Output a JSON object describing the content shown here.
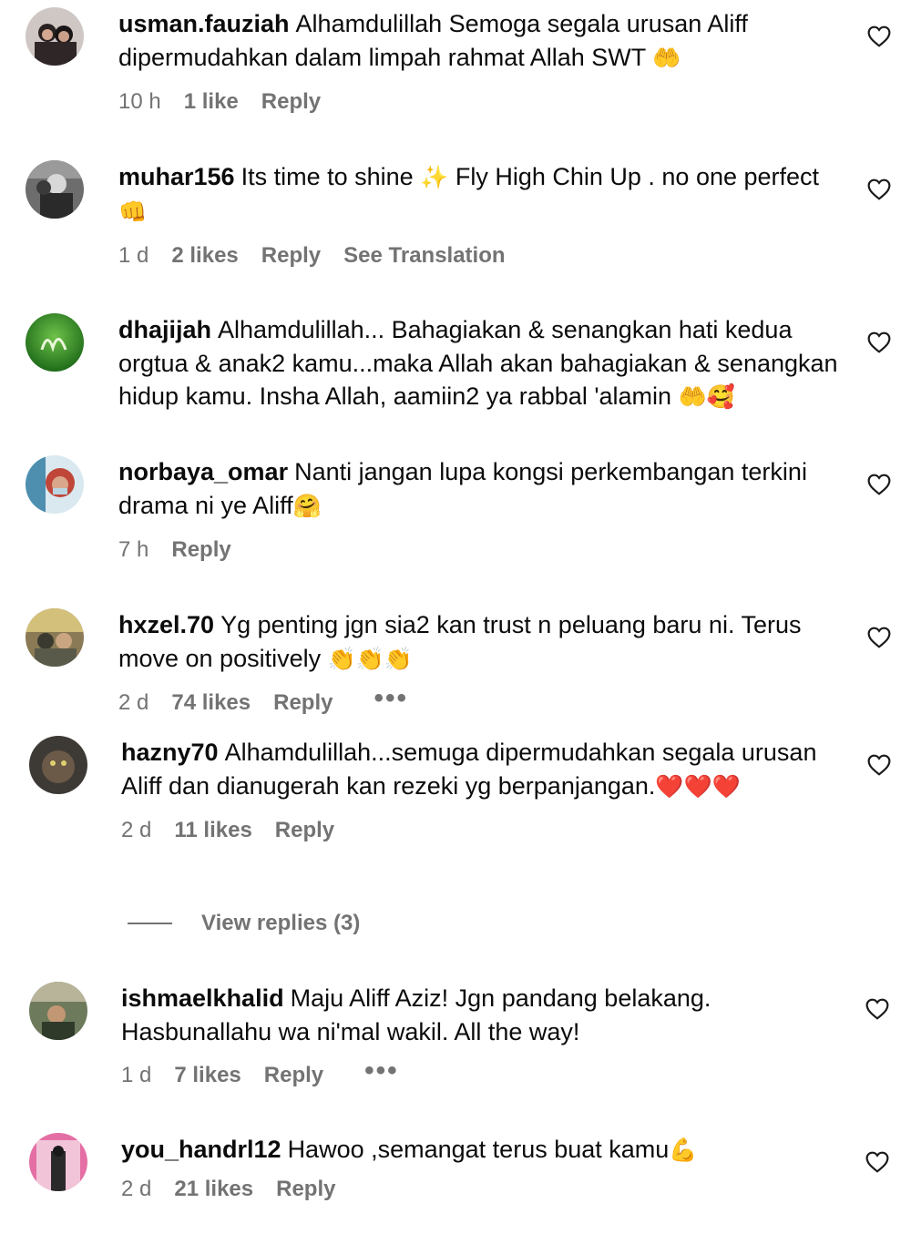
{
  "comments": [
    {
      "username": "usman.fauziah",
      "text": "Alhamdulillah Semoga segala urusan Aliff dipermudahkan dalam limpah rahmat Allah SWT",
      "emoji": "🤲",
      "time": "10 h",
      "likes": "1 like",
      "reply": "Reply"
    },
    {
      "username": "muhar156",
      "text_a": "Its time to shine",
      "emoji_a": "✨",
      "text_b": "Fly High Chin Up . no one perfect",
      "emoji_b": "👊",
      "time": "1 d",
      "likes": "2 likes",
      "reply": "Reply",
      "translate": "See Translation"
    },
    {
      "username": "dhajijah",
      "text": "Alhamdulillah... Bahagiakan & senangkan hati kedua orgtua & anak2 kamu...maka Allah akan bahagiakan & senangkan hidup kamu. Insha Allah, aamiin2 ya rabbal 'alamin",
      "emoji": "🤲🥰"
    },
    {
      "username": "norbaya_omar",
      "text": "Nanti jangan lupa kongsi perkembangan terkini drama ni ye Aliff",
      "emoji": "🤗",
      "time": "7 h",
      "reply": "Reply"
    },
    {
      "username": "hxzel.70",
      "text": "Yg penting jgn sia2 kan trust n peluang baru ni. Terus move on positively",
      "emoji": "👏👏👏",
      "time": "2 d",
      "likes": "74 likes",
      "reply": "Reply",
      "more": "•••"
    },
    {
      "username": "hazny70",
      "text": "Alhamdulillah...semuga dipermudahkan segala urusan Aliff dan dianugerah kan rezeki yg berpanjangan.",
      "emoji": "❤️❤️❤️",
      "time": "2 d",
      "likes": "11 likes",
      "reply": "Reply"
    },
    {
      "username": "ishmaelkhalid",
      "text": "Maju Aliff Aziz! Jgn pandang belakang. Hasbunallahu wa ni'mal wakil. All the way!",
      "time": "1 d",
      "likes": "7 likes",
      "reply": "Reply",
      "more": "•••"
    },
    {
      "username": "you_handrl12",
      "text": "Hawoo ,semangat terus buat kamu",
      "emoji": "💪",
      "time": "2 d",
      "likes": "21 likes",
      "reply": "Reply"
    }
  ],
  "view_replies": "View replies (3)",
  "icons": {
    "heart": "heart-outline-icon",
    "more": "more-options-icon"
  },
  "colors": {
    "text": "#0b0b0b",
    "meta": "#737373"
  }
}
